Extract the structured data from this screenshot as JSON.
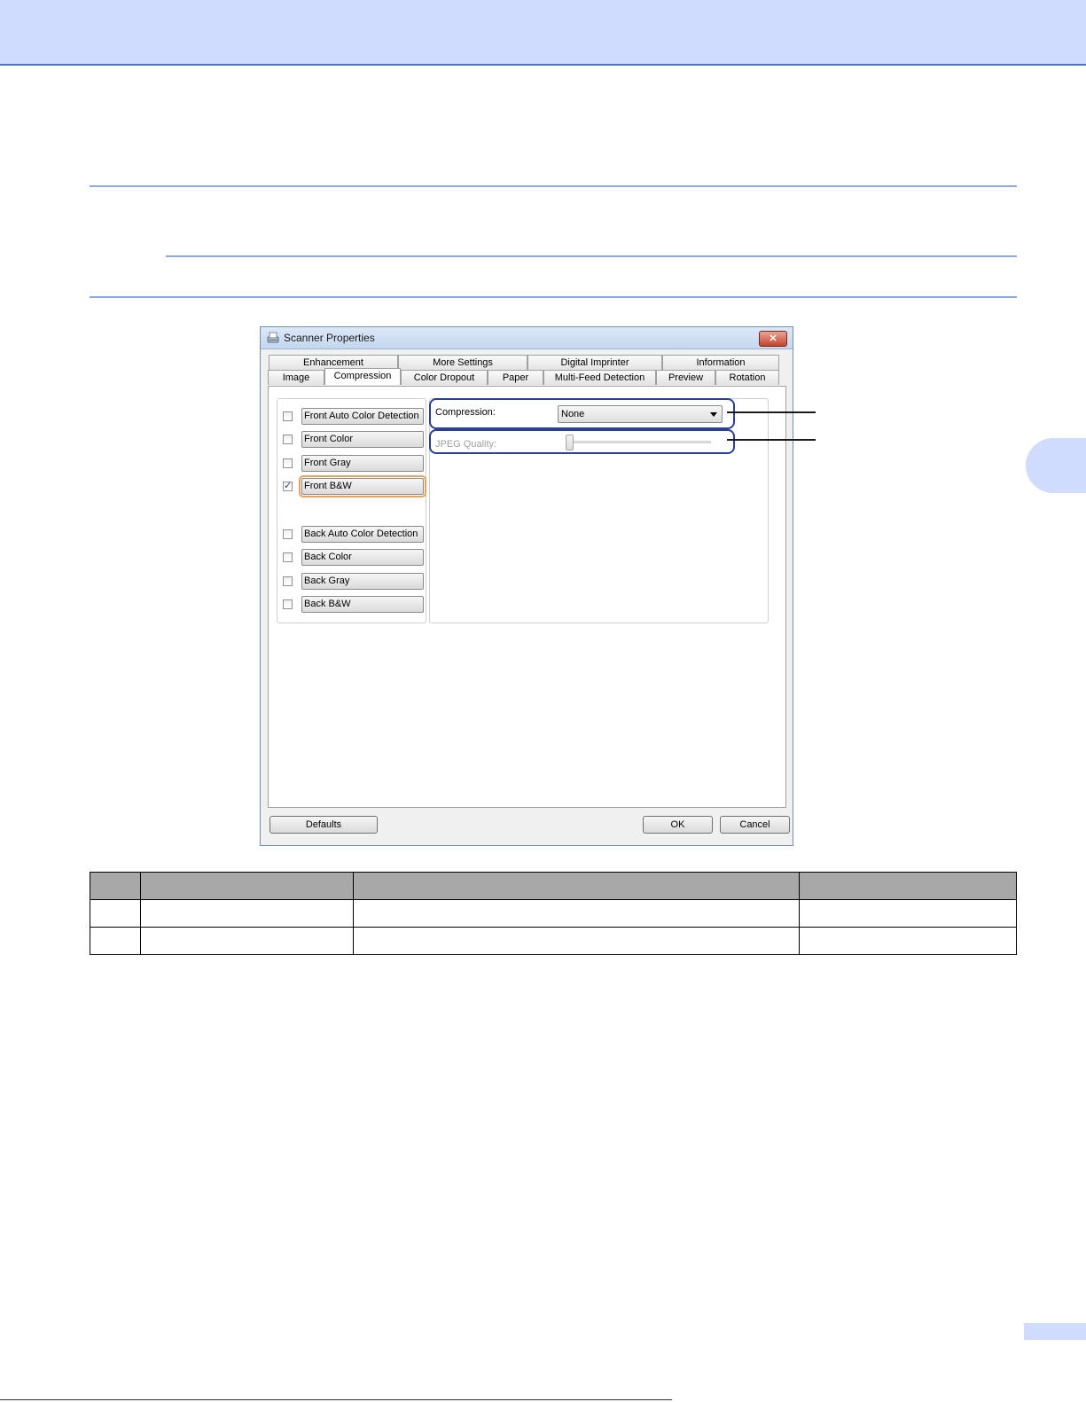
{
  "dialog": {
    "title": "Scanner Properties",
    "close_glyph": "✕",
    "tabs_row1": [
      "Enhancement",
      "More Settings",
      "Digital Imprinter",
      "Information"
    ],
    "tabs_row2": [
      "Image",
      "Compression",
      "Color Dropout",
      "Paper",
      "Multi-Feed Detection",
      "Preview",
      "Rotation"
    ],
    "selected_tab": "Compression",
    "image_types": [
      {
        "label": "Front Auto Color Detection",
        "checked": false
      },
      {
        "label": "Front Color",
        "checked": false
      },
      {
        "label": "Front Gray",
        "checked": false
      },
      {
        "label": "Front B&W",
        "checked": true
      },
      {
        "label": "Back Auto Color Detection",
        "checked": false
      },
      {
        "label": "Back Color",
        "checked": false
      },
      {
        "label": "Back Gray",
        "checked": false
      },
      {
        "label": "Back B&W",
        "checked": false
      }
    ],
    "check_glyph": "✓",
    "compression_label": "Compression:",
    "compression_value": "None",
    "jpeg_quality_label": "JPEG Quality:",
    "buttons": {
      "defaults": "Defaults",
      "ok": "OK",
      "cancel": "Cancel"
    }
  },
  "colors": {
    "header_band": "#cfdcfd",
    "rule": "#8aa7e8",
    "callout": "#2b3e9e",
    "table_header": "#a8a8a8"
  }
}
